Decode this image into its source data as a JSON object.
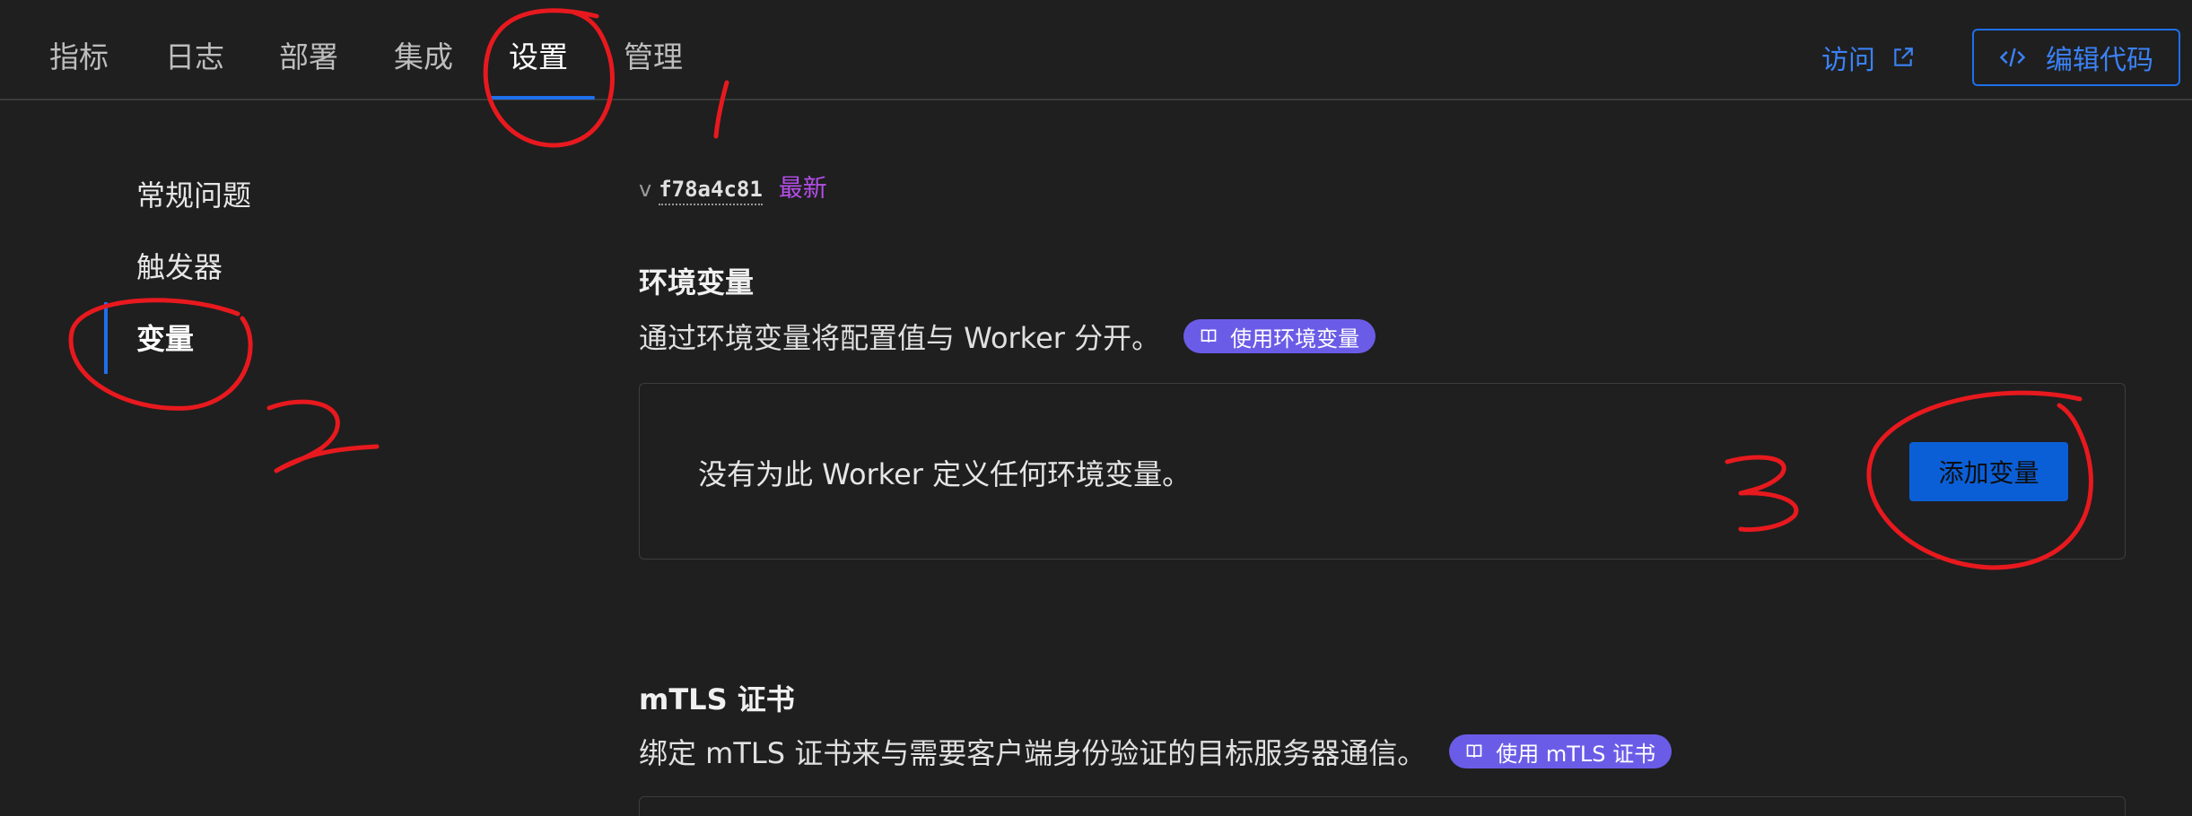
{
  "topnav": {
    "tabs": [
      {
        "label": "指标"
      },
      {
        "label": "日志"
      },
      {
        "label": "部署"
      },
      {
        "label": "集成"
      },
      {
        "label": "设置",
        "active": true
      },
      {
        "label": "管理"
      }
    ],
    "visit_label": "访问",
    "edit_code_label": "编辑代码"
  },
  "sidebar": {
    "items": [
      {
        "label": "常规问题"
      },
      {
        "label": "触发器"
      },
      {
        "label": "变量",
        "active": true
      }
    ]
  },
  "version": {
    "prefix": "v",
    "hash": "f78a4c81",
    "badge": "最新"
  },
  "env_vars": {
    "title": "环境变量",
    "description": "通过环境变量将配置值与 Worker 分开。",
    "doc_pill": "使用环境变量",
    "empty_text": "没有为此 Worker 定义任何环境变量。",
    "add_button": "添加变量"
  },
  "mtls": {
    "title": "mTLS 证书",
    "description": "绑定 mTLS 证书来与需要客户端身份验证的目标服务器通信。",
    "doc_pill": "使用 mTLS 证书"
  },
  "colors": {
    "background": "#1f1f1f",
    "accent": "#1f6feb",
    "pill": "#6b5ce7",
    "latest": "#b44ee8",
    "annotation": "#e8191e"
  },
  "icons": [
    "external-link-icon",
    "code-icon",
    "book-icon"
  ]
}
